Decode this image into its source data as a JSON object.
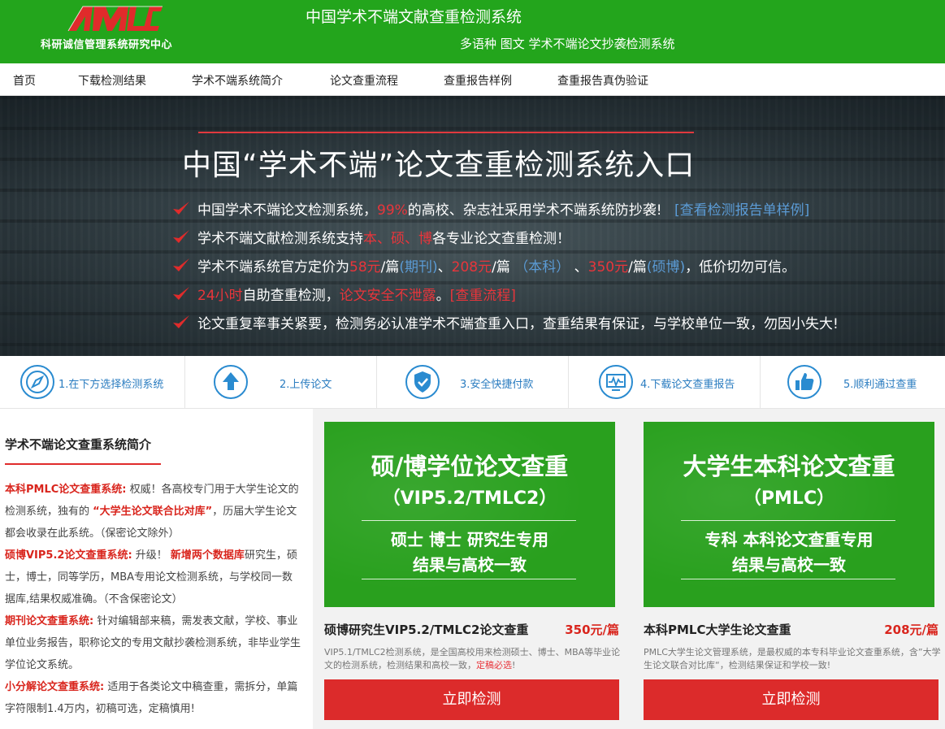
{
  "header": {
    "logo_sub": "科研诚信管理系统研究中心",
    "title": "中国学术不端文献查重检测系统",
    "subtitle": "多语种 图文 学术不端论文抄袭检测系统"
  },
  "nav": [
    "首页",
    "下载检测结果",
    "学术不端系统简介",
    "论文查重流程",
    "查重报告样例",
    "查重报告真伪验证"
  ],
  "hero": {
    "title": "中国“学术不端”论文查重检测系统入口",
    "b1": {
      "a": "中国学术不端论文检测系统，",
      "b": "99%",
      "c": "的高校、杂志社采用学术不端系统防抄袭!",
      "d": "[查看检测报告单样例]"
    },
    "b2": {
      "a": "学术不端文献检测系统支持",
      "b": "本、硕、博",
      "c": "各专业论文查重检测！"
    },
    "b3": {
      "a": "学术不端系统官方定价为",
      "p1": "58元",
      "s1": "/篇",
      "t1": "(期刊)",
      "sep1": "、",
      "p2": "208元",
      "s2": "/篇 ",
      "t2": "（本科）",
      "sep2": " 、",
      "p3": "350元",
      "s3": "/篇",
      "t3": "(硕博)",
      "e": "，低价切勿可信。"
    },
    "b4": {
      "a": "24小时",
      "b": "自助查重检测，",
      "c": "论文安全不泄露",
      "d": "。",
      "e": "[查重流程]"
    },
    "b5": "论文重复率事关紧要，检测务必认准学术不端查重入口，查重结果有保证，与学校单位一致，勿因小失大!"
  },
  "steps": [
    "1.在下方选择检测系统",
    "2.上传论文",
    "3.安全快捷付款",
    "4.下载论文查重报告",
    "5.顺利通过查重"
  ],
  "intro": {
    "title": "学术不端论文查重系统简介",
    "p1_k": "本科PMLC论文查重系统:",
    "p1_a": " 权威！各高校专门用于大学生论文的检测系统，独有的 ",
    "p1_q": "“大学生论文联合比对库”",
    "p1_b": "，历届大学生论文都会收录在此系统。（保密论文除外）",
    "p2_k": "硕博VIP5.2论文查重系统:",
    "p2_a": " 升级！ ",
    "p2_q": "新增两个数据库",
    "p2_b": "研究生，硕士，博士，同等学历，MBA专用论文检测系统，与学校同一数据库,结果权威准确。（不含保密论文）",
    "p3_k": "期刊论文查重系统:",
    "p3_a": " 针对编辑部来稿，需发表文献，学校、事业单位业务报告，职称论文的专用文献抄袭检测系统，非毕业学生学位论文系统。",
    "p4_k": "小分解论文查重系统:",
    "p4_a": " 适用于各类论文中稿查重，需拆分，单篇字符限制1.4万内，初稿可选，定稿慎用!"
  },
  "cards": [
    {
      "h1": "硕/博学位论文查重",
      "h2": "（VIP5.2/TMLC2）",
      "l1": "硕士 博士 研究生专用",
      "l2": "结果与高校一致",
      "name": "硕博研究生VIP5.2/TMLC2论文查重",
      "price": "350元/篇",
      "desc_a": "VIP5.1/TMLC2检测系统，是全国高校用来检测硕士、博士、MBA等毕业论文的检测系统，检测结果和高校一致，",
      "desc_b": "定稿必选",
      "desc_c": "!",
      "button": "立即检测"
    },
    {
      "h1": "大学生本科论文查重",
      "h2": "（PMLC）",
      "l1": "专科 本科论文查重专用",
      "l2": "结果与高校一致",
      "name": "本科PMLC大学生论文查重",
      "price": "208元/篇",
      "desc_a": "PMLC大学生论文管理系统，是最权威的本专科毕业论文查重系统，含”大学生论文联合对比库“，检测结果保证和学校一致!",
      "desc_b": "",
      "desc_c": "",
      "button": "立即检测"
    }
  ],
  "colors": {
    "brand_green": "#23a51c",
    "accent_red": "#e8353b",
    "link_blue": "#5b9bd5"
  }
}
